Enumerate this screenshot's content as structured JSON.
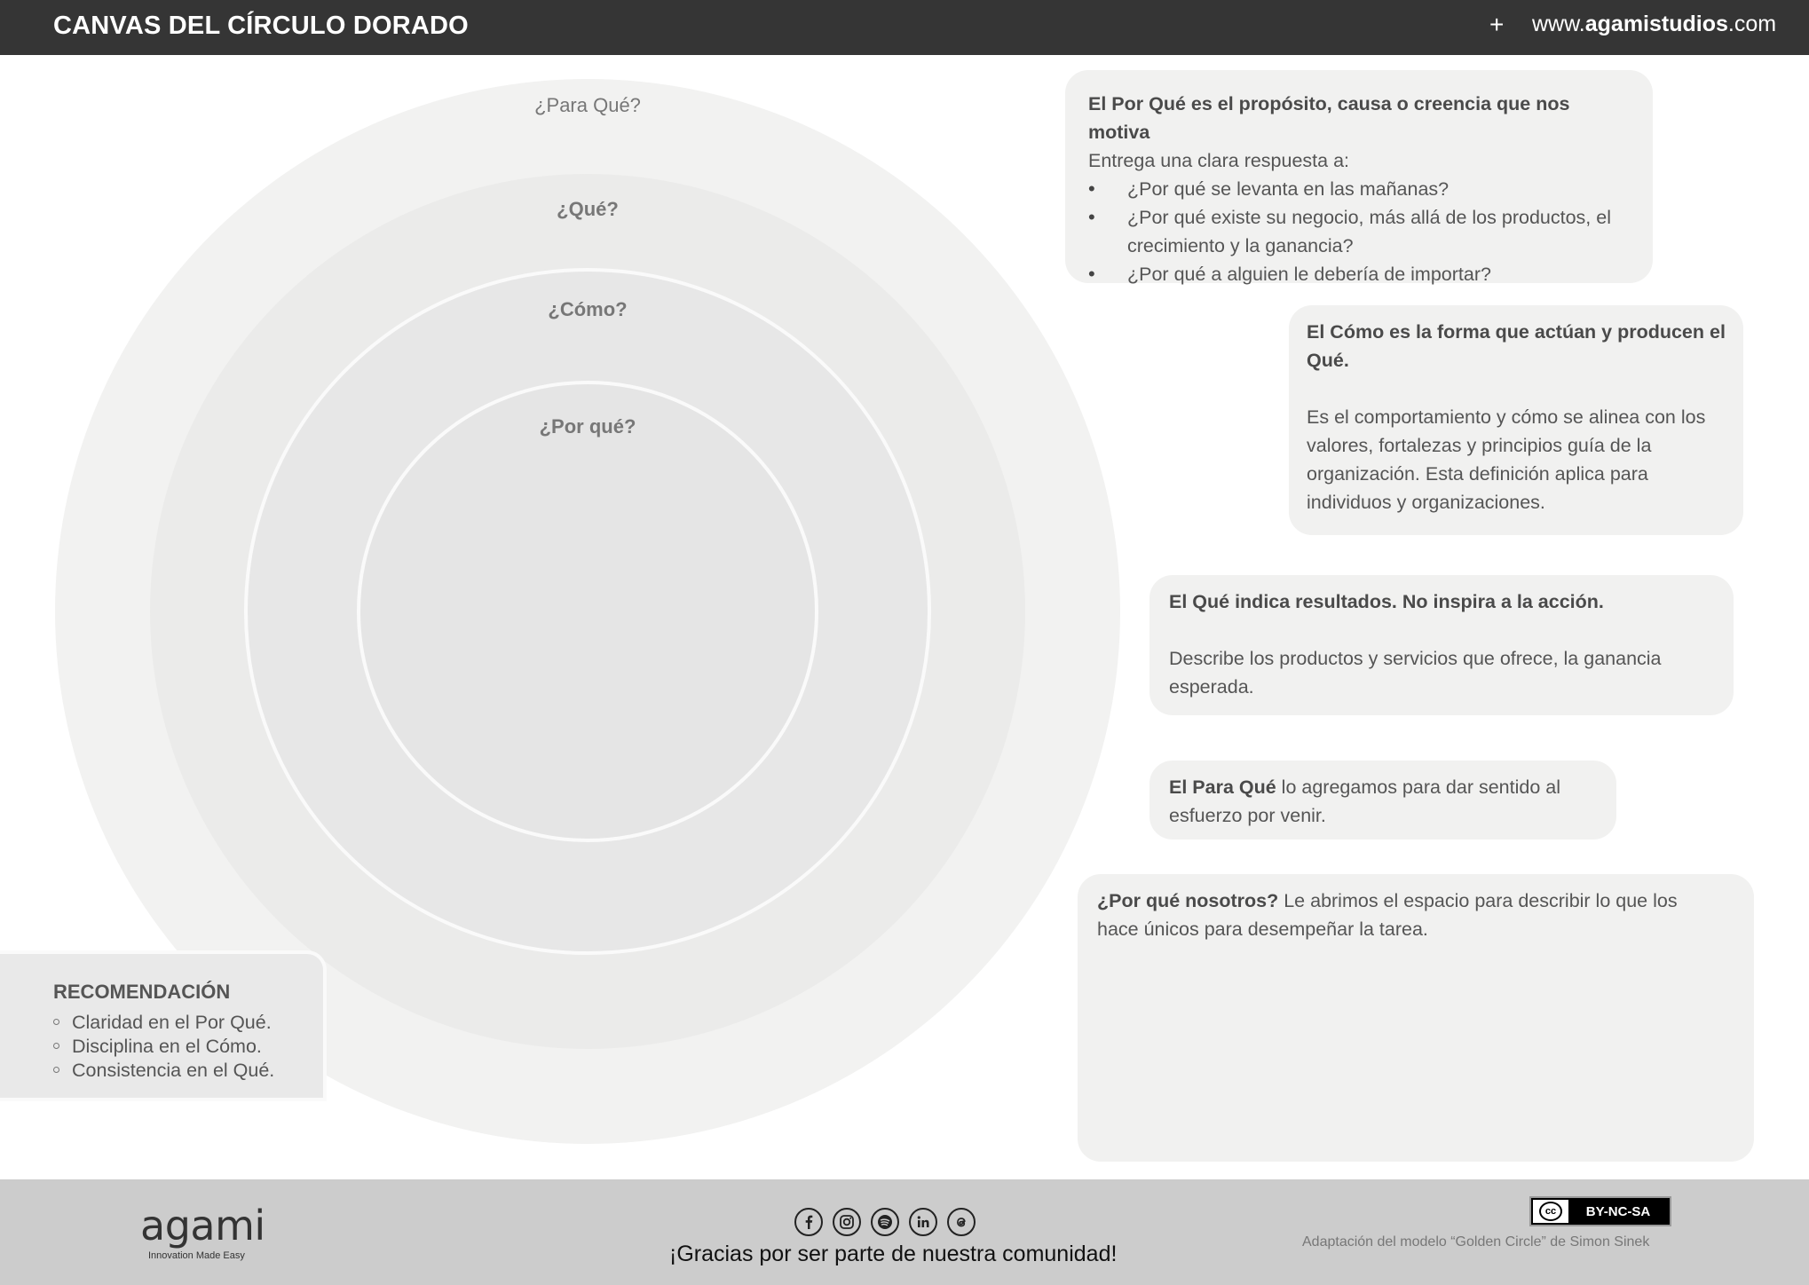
{
  "header": {
    "title": "CANVAS DEL CÍRCULO DORADO",
    "plus": "+",
    "site_prefix": "www.",
    "site_brand": "agamistudios",
    "site_suffix": ".com"
  },
  "circles": {
    "para_que": "¿Para Qué?",
    "que": "¿Qué?",
    "como": "¿Cómo?",
    "por_que": "¿Por qué?"
  },
  "cards": {
    "por_que": {
      "heading": "El Por Qué es el propósito, causa o creencia que nos motiva",
      "intro": "Entrega una clara respuesta a:",
      "bullets": [
        "¿Por qué se levanta en las mañanas?",
        "¿Por qué existe su negocio, más allá de los productos, el crecimiento y la ganancia?",
        "¿Por qué a alguien le debería de importar?"
      ]
    },
    "como": {
      "heading": "El Cómo es la forma que actúan y producen el Qué.",
      "body": "Es el comportamiento y cómo se alinea con los valores, fortalezas y principios guía de la organización. Esta definición aplica para individuos y organizaciones."
    },
    "que": {
      "heading": "El Qué indica resultados. No inspira a la acción.",
      "body": "Describe los productos y servicios que ofrece, la ganancia esperada."
    },
    "para_que": {
      "bold": "El Para Qué",
      "rest": " lo agregamos para dar sentido al esfuerzo por venir."
    },
    "nosotros": {
      "bold": "¿Por qué nosotros?",
      "rest": " Le abrimos el espacio para describir lo que los hace únicos para desempeñar la tarea."
    }
  },
  "recommendation": {
    "title": "RECOMENDACIÓN",
    "items": [
      "Claridad en el Por Qué.",
      "Disciplina en el Cómo.",
      "Consistencia en el Qué."
    ]
  },
  "footer": {
    "logo": "agami",
    "tagline": "Innovation Made Easy",
    "social_icons": [
      "facebook-icon",
      "instagram-icon",
      "spotify-icon",
      "linkedin-icon",
      "threads-icon"
    ],
    "thanks": "¡Gracias por ser parte de nuestra comunidad!",
    "license": "BY-NC-SA",
    "license_cc": "cc",
    "attribution": "Adaptación del modelo “Golden Circle” de Simon Sinek"
  }
}
